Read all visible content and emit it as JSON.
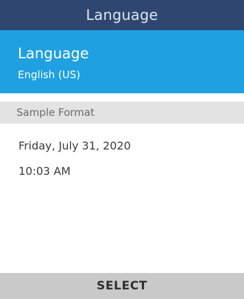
{
  "header": {
    "title": "Language"
  },
  "selected_item": {
    "label": "Language",
    "value": "English (US)"
  },
  "sample_section": {
    "header": "Sample Format",
    "date": "Friday, July 31, 2020",
    "time": "10:03 AM"
  },
  "softkeys": {
    "center": "SELECT"
  },
  "colors": {
    "title_bar": "#2f4770",
    "selected_item": "#1fa0e0",
    "section_header": "#e3e3e3",
    "softkey_bar": "#c9c9c9"
  }
}
